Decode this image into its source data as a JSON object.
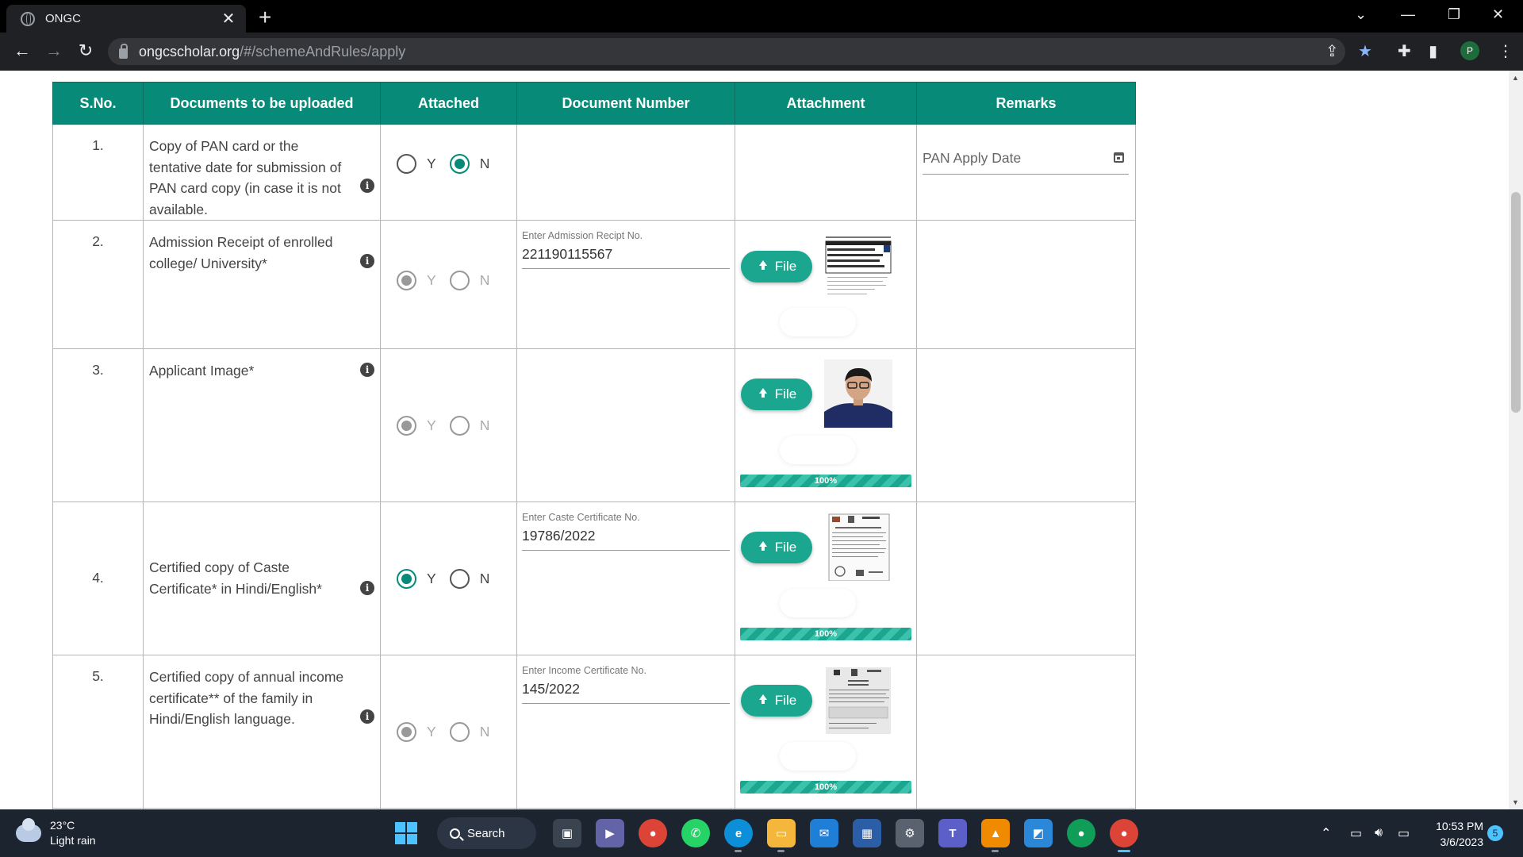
{
  "browser": {
    "tab_title": "ONGC",
    "tab_close": "✕",
    "new_tab": "+",
    "url_host": "ongcscholar.org",
    "url_path": "/#/schemeAndRules/apply",
    "profile_initial": "P"
  },
  "table": {
    "headers": [
      "S.No.",
      "Documents to be uploaded",
      "Attached",
      "Document Number",
      "Attachment",
      "Remarks"
    ],
    "radio_yes": "Y",
    "radio_no": "N",
    "file_button": "File",
    "info_glyph": "i",
    "rows": [
      {
        "sno": "1.",
        "document": "Copy of PAN card or the tentative date for submission of PAN card copy (in case it is not available.",
        "attached": "N",
        "attached_enabled": true,
        "remarks_placeholder": "PAN Apply Date"
      },
      {
        "sno": "2.",
        "document": "Admission Receipt of enrolled college/ University*",
        "attached": "Y",
        "attached_enabled": false,
        "number_label": "Enter Admission Recipt No.",
        "number_value": "221190115567"
      },
      {
        "sno": "3.",
        "document": "Applicant Image*",
        "attached": "Y",
        "attached_enabled": false,
        "progress": "100%"
      },
      {
        "sno": "4.",
        "document": "Certified copy of Caste Certificate* in Hindi/English*",
        "attached": "Y",
        "attached_enabled": true,
        "number_label": "Enter Caste Certificate No.",
        "number_value": "19786/2022",
        "progress": "100%"
      },
      {
        "sno": "5.",
        "document": "Certified copy of annual income certificate** of the family in Hindi/English language.",
        "attached": "Y",
        "attached_enabled": false,
        "number_label": "Enter Income Certificate No.",
        "number_value": "145/2022",
        "progress": "100%"
      }
    ]
  },
  "taskbar": {
    "temperature": "23°C",
    "weather": "Light rain",
    "search_label": "Search",
    "time": "10:53 PM",
    "date": "3/6/2023",
    "notification_count": "5"
  },
  "colors": {
    "header_teal": "#078a78",
    "button_teal": "#1aa68f"
  }
}
